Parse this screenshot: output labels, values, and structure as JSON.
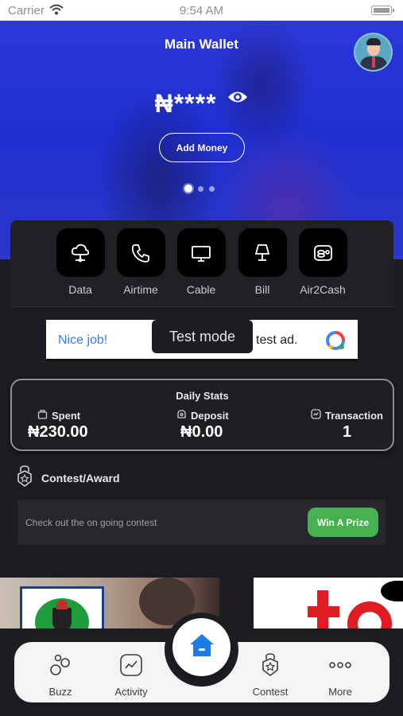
{
  "status_bar": {
    "carrier": "Carrier",
    "time": "9:54 AM"
  },
  "wallet": {
    "title": "Main Wallet",
    "balance_masked": "₦****",
    "add_money_label": "Add Money",
    "carousel_pages": 3,
    "carousel_active_index": 0
  },
  "services": [
    {
      "label": "Data",
      "icon": "cloud-network-icon"
    },
    {
      "label": "Airtime",
      "icon": "phone-icon"
    },
    {
      "label": "Cable",
      "icon": "tv-icon"
    },
    {
      "label": "Bill",
      "icon": "lamp-icon"
    },
    {
      "label": "Air2Cash",
      "icon": "coins-icon"
    }
  ],
  "ad": {
    "text_left": "Nice job!",
    "text_right": "test ad.",
    "toast": "Test mode"
  },
  "stats": {
    "title": "Daily Stats",
    "spent_label": "Spent",
    "spent_value": "₦230.00",
    "deposit_label": "Deposit",
    "deposit_value": "₦0.00",
    "transaction_label": "Transaction",
    "transaction_value": "1"
  },
  "contest": {
    "heading": "Contest/Award",
    "message": "Check out the on going contest",
    "button_label": "Win A Prize"
  },
  "nav": {
    "buzz": "Buzz",
    "activity": "Activity",
    "contest": "Contest",
    "more": "More"
  },
  "colors": {
    "hero_blue": "#2433d6",
    "accent_blue": "#1e7be6",
    "win_green": "#45b24f",
    "background": "#1b1d22"
  }
}
